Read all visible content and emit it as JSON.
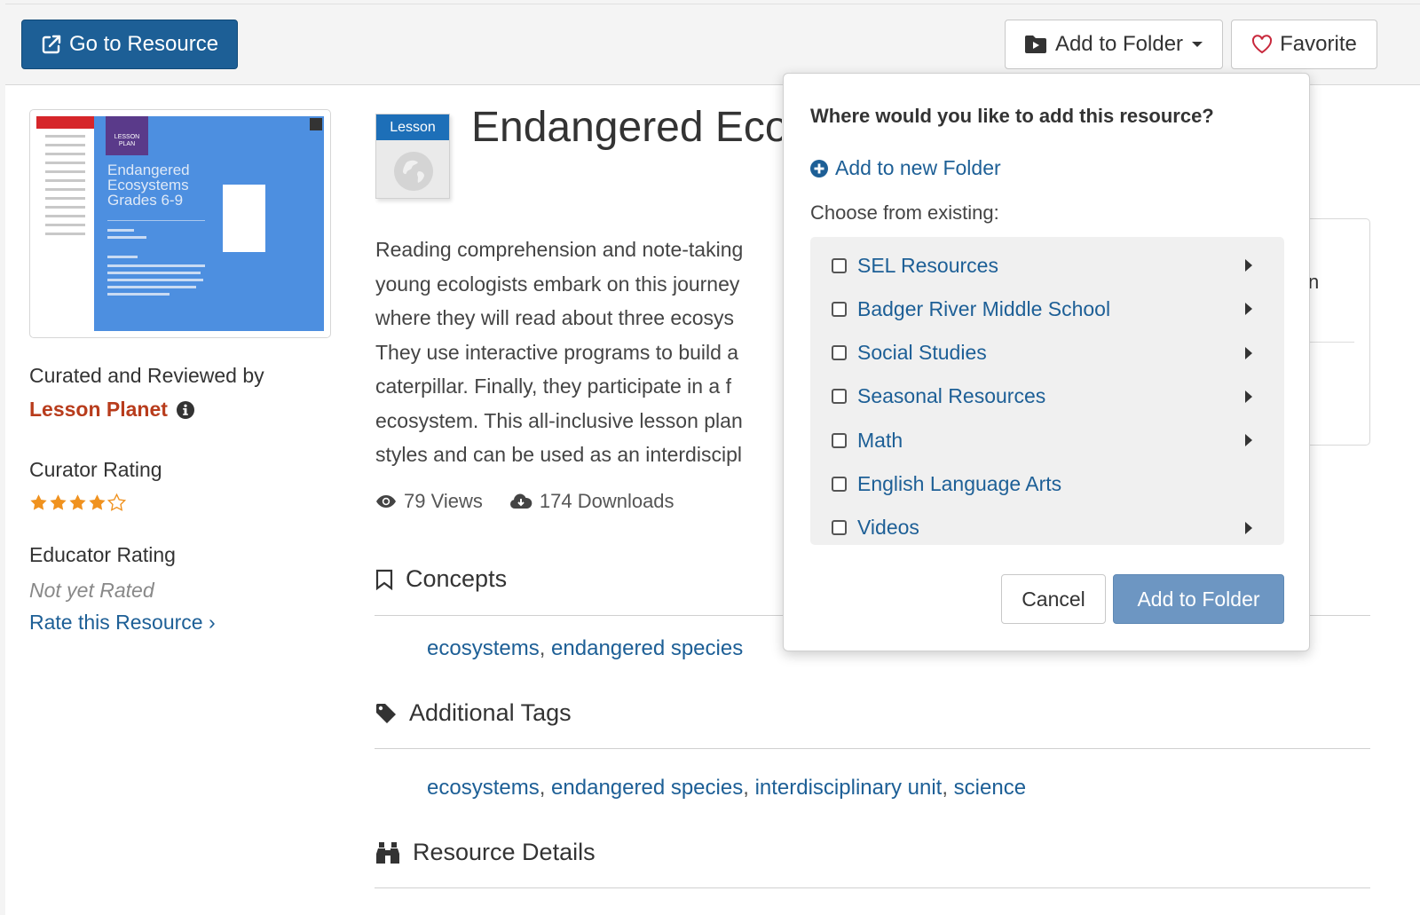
{
  "toolbar": {
    "go_label": "Go to Resource",
    "folder_label": "Add to Folder",
    "favorite_label": "Favorite"
  },
  "sidebar": {
    "curated_label": "Curated and Reviewed by",
    "provider": "Lesson Planet",
    "curator_rating_label": "Curator Rating",
    "curator_rating": 4,
    "curator_rating_max": 5,
    "educator_rating_label": "Educator Rating",
    "educator_rating_value": "Not yet Rated",
    "rate_link": "Rate this Resource ›"
  },
  "thumbnail": {
    "badge": "LESSON PLAN",
    "title_lines": [
      "Endangered",
      "Ecosystems",
      "Grades 6-9"
    ]
  },
  "resource": {
    "type_tag": "Lesson",
    "title": "Endangered Eco",
    "description_lines": [
      "Reading comprehension and note-taking",
      "young ecologists embark on this journey",
      "where they will read about three ecosys",
      "They use interactive programs to build a",
      "caterpillar. Finally, they participate in a f",
      "ecosystem. This all-inclusive lesson plan",
      "styles and can be used as an interdiscipl"
    ],
    "views": "79 Views",
    "downloads": "174 Downloads"
  },
  "sections": {
    "concepts_title": "Concepts",
    "concepts": [
      "ecosystems",
      "endangered species"
    ],
    "tags_title": "Additional Tags",
    "tags": [
      "ecosystems",
      "endangered species",
      "interdisciplinary unit",
      "science"
    ],
    "details_title": "Resource Details"
  },
  "right_card": {
    "partial_char": "n"
  },
  "popover": {
    "title": "Where would you like to add this resource?",
    "new_folder": "Add to new Folder",
    "choose_label": "Choose from existing:",
    "folders": [
      {
        "label": "SEL Resources",
        "has_sub": true
      },
      {
        "label": "Badger River Middle School",
        "has_sub": true
      },
      {
        "label": "Social Studies",
        "has_sub": true
      },
      {
        "label": "Seasonal Resources",
        "has_sub": true
      },
      {
        "label": "Math",
        "has_sub": true
      },
      {
        "label": "English Language Arts",
        "has_sub": false
      },
      {
        "label": "Videos",
        "has_sub": true
      }
    ],
    "cancel_label": "Cancel",
    "add_label": "Add to Folder"
  },
  "colors": {
    "primary": "#1d5f96",
    "provider": "#b83c1c",
    "star": "#f0921f",
    "lesson_tag": "#1d6fb8"
  }
}
